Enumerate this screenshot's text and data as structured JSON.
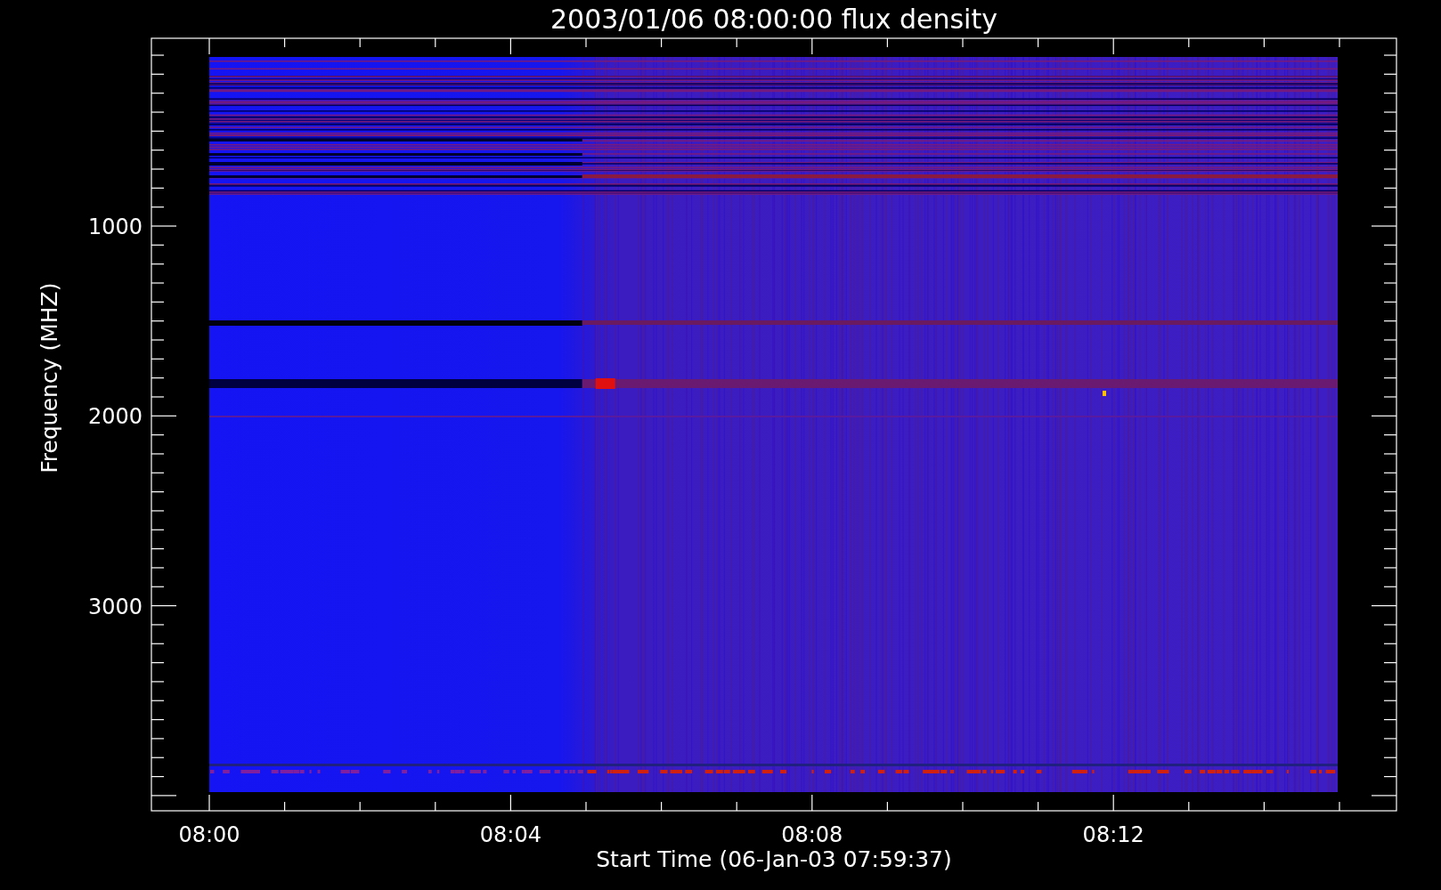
{
  "plot": {
    "title": "2003/01/06 08:00:00 flux density",
    "xlabel": "Start Time (06-Jan-03 07:59:37)",
    "ylabel": "Frequency (MHZ)",
    "xtick_labels": [
      "08:00",
      "08:04",
      "08:08",
      "08:12"
    ],
    "ytick_labels": [
      "1000",
      "2000",
      "3000"
    ]
  }
}
